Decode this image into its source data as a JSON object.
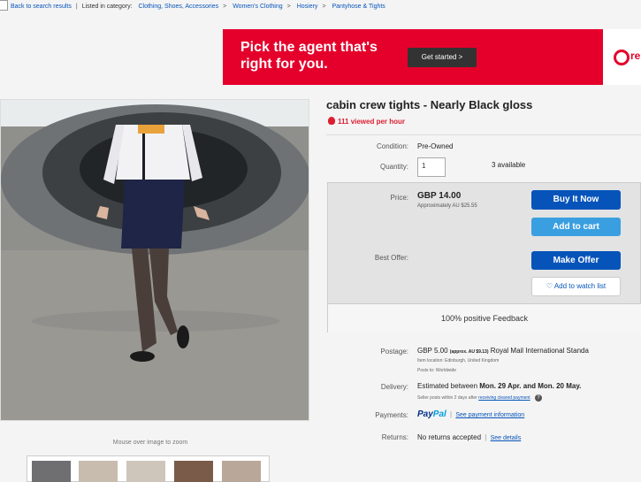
{
  "breadcrumb": {
    "back": "Back to search results",
    "listed": "Listed in category:",
    "items": [
      "Clothing, Shoes, Accessories",
      "Women's Clothing",
      "Hosiery",
      "Pantyhose & Tights"
    ],
    "separator": ">"
  },
  "ad": {
    "headline": "Pick the agent that's right for you.",
    "cta": "Get started >",
    "logo_text": "re",
    "brand_color": "#e4002b"
  },
  "listing": {
    "title": "cabin crew tights - Nearly Black gloss",
    "views": "111 viewed per hour",
    "condition_label": "Condition:",
    "condition": "Pre-Owned",
    "quantity_label": "Quantity:",
    "quantity_value": "1",
    "available": "3 available",
    "price_label": "Price:",
    "price": "GBP 14.00",
    "price_approx": "Approximately AU $25.55",
    "buy_now": "Buy It Now",
    "add_to_cart": "Add to cart",
    "best_offer_label": "Best Offer:",
    "make_offer": "Make Offer",
    "watch": "Add to watch list",
    "feedback": "100% positive Feedback"
  },
  "shipping": {
    "postage_label": "Postage:",
    "postage": "GBP 5.00",
    "postage_approx": "(approx. AU $9.13)",
    "postage_service": "Royal Mail International Standa",
    "item_location": "Item location:  Edinburgh, United Kingdom",
    "posts_to": "Posts to:  Worldwide",
    "delivery_label": "Delivery:",
    "delivery_prefix": "Estimated between ",
    "delivery_dates": "Mon. 29 Apr. and Mon. 20 May.",
    "seller_posts": "Seller posts within 2 days after ",
    "cleared_payment": "receiving cleared payment",
    "payments_label": "Payments:",
    "paypal_1": "Pay",
    "paypal_2": "Pal",
    "payment_info": "See payment information",
    "returns_label": "Returns:",
    "returns": "No returns accepted",
    "see_details": "See details"
  },
  "gallery": {
    "zoom_hint": "Mouse over image to zoom",
    "thumb_count": 5
  },
  "colors": {
    "link": "#0654ba",
    "button_blue": "#0654ba",
    "button_light": "#3a9fe0",
    "views_red": "#dd1e31"
  },
  "icons": [
    "back-arrow-icon",
    "fire-icon",
    "heart-icon",
    "help-icon",
    "agent-logo-icon"
  ]
}
